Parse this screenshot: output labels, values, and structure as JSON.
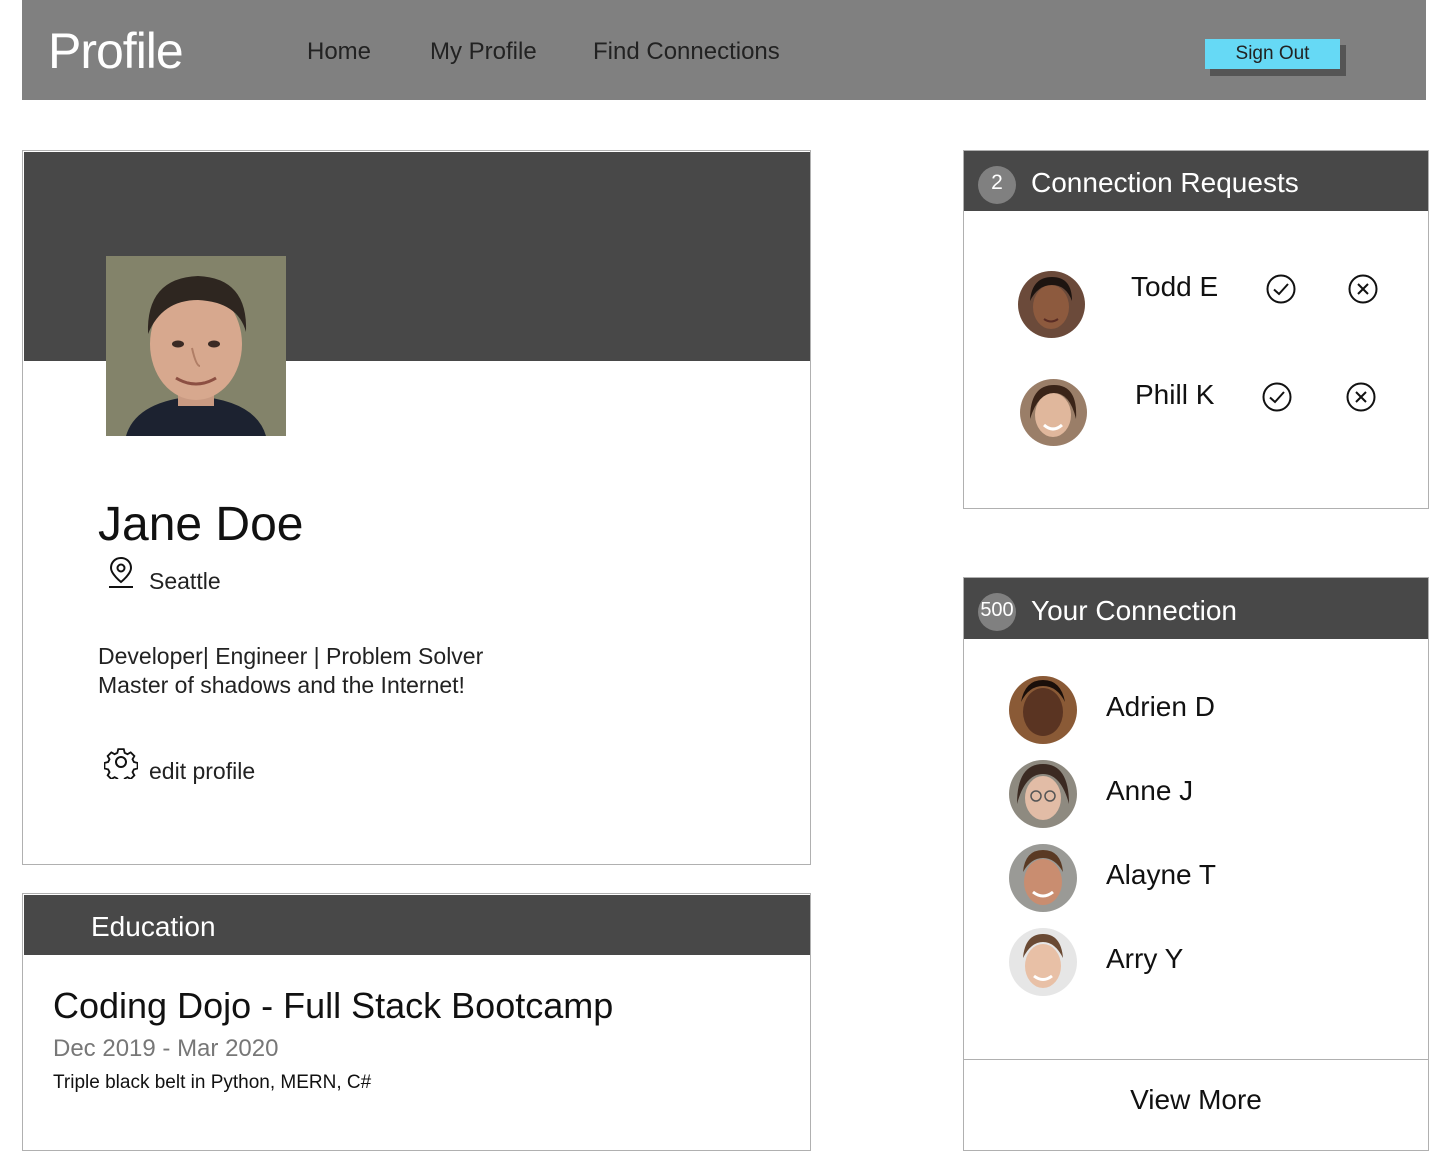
{
  "header": {
    "brand": "Profile",
    "nav": [
      "Home",
      "My Profile",
      "Find Connections"
    ],
    "sign_out_label": "Sign Out",
    "background": "#808080",
    "button_color": "#66d9f5"
  },
  "profile": {
    "name": "Jane Doe",
    "location": "Seattle",
    "bio_line1": "Developer| Engineer | Problem Solver",
    "bio_line2": "Master of shadows and the Internet!",
    "edit_label": "edit profile",
    "icons": [
      "map-pin-icon",
      "gear-icon"
    ]
  },
  "education": {
    "title": "Education",
    "school": "Coding Dojo - Full Stack Bootcamp",
    "dates": "Dec 2019 - Mar 2020",
    "description": "Triple black belt in Python, MERN, C#"
  },
  "requests": {
    "count": "2",
    "title": "Connection Requests",
    "items": [
      {
        "name": "Todd E"
      },
      {
        "name": "Phill K"
      }
    ],
    "icons": [
      "accept-check-icon",
      "reject-x-icon"
    ]
  },
  "connections": {
    "count": "500",
    "title": "Your Connection",
    "items": [
      {
        "name": "Adrien D"
      },
      {
        "name": "Anne J"
      },
      {
        "name": "Alayne T"
      },
      {
        "name": "Arry Y"
      }
    ],
    "view_more": "View More"
  },
  "colors": {
    "dark_bar": "#484848",
    "badge": "#808080"
  }
}
